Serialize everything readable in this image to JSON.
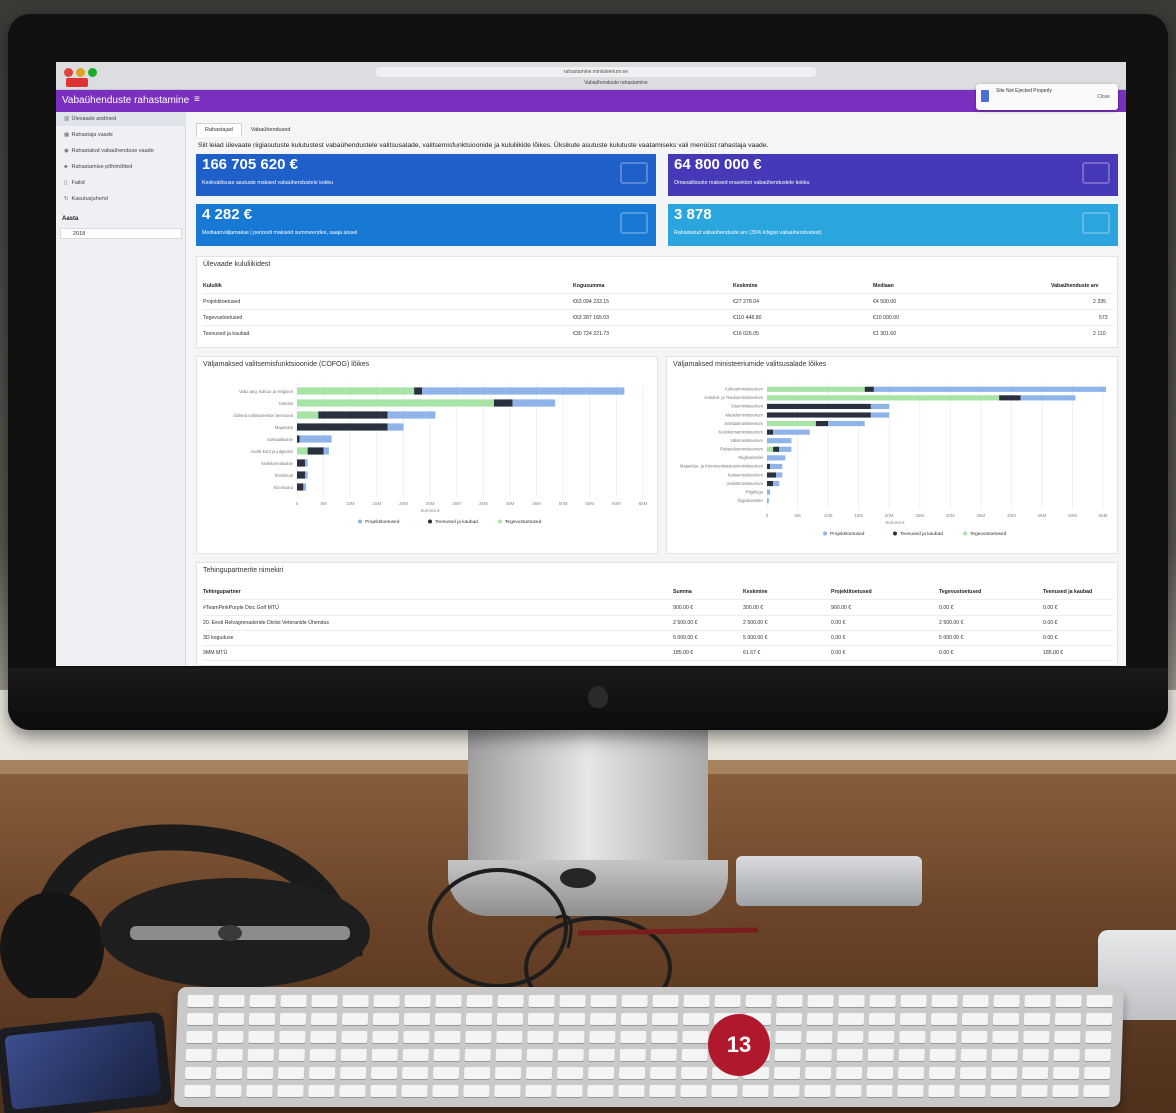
{
  "browser": {
    "url": "rahastamine.ministeerium.ee",
    "tab_title": "Vabaühenduste rahastamine"
  },
  "app": {
    "title": "Vabaühenduste rahastamine",
    "menu_icon": "hamburger-icon"
  },
  "toast": {
    "title": "Site Not Ejected Properly",
    "close_label": "Close"
  },
  "sidebar": {
    "items": [
      {
        "icon": "chart-icon",
        "label": "Ülevaade andmed"
      },
      {
        "icon": "grid-icon",
        "label": "Rahastaja vaade"
      },
      {
        "icon": "globe-icon",
        "label": "Rahastatud vabaühenduse vaade"
      },
      {
        "icon": "people-icon",
        "label": "Rahastamise põhimõtted"
      },
      {
        "icon": "file-icon",
        "label": "Failid"
      },
      {
        "icon": "refresh-icon",
        "label": "Kasutusjuhend"
      }
    ],
    "year_heading": "Aasta",
    "year_value": "2018"
  },
  "tabs": [
    "Rahastajad",
    "Vabaühendused"
  ],
  "intro": "Siit leiad ülevaate riigiasutuste kulutustest vabaühendustele valitsusalade, valitsemisfunktsioonide ja kululiikide lõikes. Üksikute asutuste kulutuste vaatamiseks vali menüüst rahastaja vaade.",
  "cards": [
    {
      "value": "166 705 620 €",
      "label": "Keskvalitsuse asutuste maksed vabaühendustele kokku",
      "color": "#1f5fc9"
    },
    {
      "value": "64 800 000 €",
      "label": "Omavalitsuste maksed erasektori vabaühendustele kokku",
      "color": "#4639b7"
    },
    {
      "value": "4 282 €",
      "label": "Mediaanväljamakse | perioodi makseid summeerides, saaja alusel",
      "color": "#1779d3"
    },
    {
      "value": "3 878",
      "label": "Rahastatud vabaühenduste arv (35% kõigist vabaühendustest)",
      "color": "#2aa5de"
    }
  ],
  "overview": {
    "title": "Ülevaade kululiikidest",
    "headers": [
      "Kululiik",
      "Kogusumma",
      "Keskmine",
      "Mediaan",
      "Vabaühenduste arv"
    ],
    "rows": [
      [
        "Projektitoetused",
        "€63 094 233.15",
        "€27 278.04",
        "€4 500.00",
        "2 335"
      ],
      [
        "Tegevustoetused",
        "€63 287 165.03",
        "€110 448.80",
        "€10 000.00",
        "573"
      ],
      [
        "Teenused ja kaubad",
        "€30 724 221.73",
        "€16 026.05",
        "€1 301.60",
        "2 110"
      ]
    ]
  },
  "cofog_chart": {
    "title": "Väljamaksed valitsemisfunktsioonide (COFOG) lõikes",
    "xlabel": "Summa €",
    "chart_data": {
      "type": "bar",
      "categories": [
        "Vaba aeg, kultuur ja religioon",
        "Haridus",
        "Üldised valitsussektori teenused",
        "Majandus",
        "Sotsiaalkaitse",
        "Avalik kord ja julgeolek",
        "Keskkonnakaitse",
        "Tervishoid",
        "Kinnisvara"
      ],
      "series": [
        {
          "name": "Projektitoetused",
          "color": "#8fb4ea",
          "values": [
            38,
            8,
            9,
            3,
            6,
            1,
            0.5,
            0.5,
            0.5
          ]
        },
        {
          "name": "Teenused ja kaubad",
          "color": "#2b3040",
          "values": [
            1.5,
            3.5,
            13,
            17,
            0.5,
            3,
            1.5,
            1.5,
            1.2
          ]
        },
        {
          "name": "Tegevustoetused",
          "color": "#a7e3a5",
          "values": [
            22,
            37,
            4,
            0,
            0,
            2,
            0,
            0,
            0
          ]
        }
      ],
      "x_ticks": [
        "0",
        "5M",
        "10M",
        "15M",
        "20M",
        "25M",
        "30M",
        "35M",
        "40M",
        "45M",
        "50M",
        "55M",
        "60M",
        "65M"
      ],
      "xlim": [
        0,
        65000000
      ]
    }
  },
  "ministry_chart": {
    "title": "Väljamaksed ministeeriumide valitsusalade lõikes",
    "xlabel": "Summa €",
    "chart_data": {
      "type": "bar",
      "categories": [
        "Kultuuriministeerium",
        "Haridus- ja Teadusministeerium",
        "Siseministeerium",
        "Maaeluministeerium",
        "Sotsiaalministeerium",
        "Keskkonnaministeerium",
        "Välisministeerium",
        "Rahandusministeerium",
        "Riigikantselei",
        "Majandus- ja Kommunikatsiooniministeerium",
        "Kaitseministeerium",
        "Justiitsministeerium",
        "Riigikogu",
        "Õiguskantsler"
      ],
      "series": [
        {
          "name": "Projektitoetused",
          "color": "#8fb4ea",
          "values": [
            38,
            9,
            3,
            3,
            6,
            6,
            4,
            2,
            3,
            2,
            1,
            1,
            0.5,
            0.3
          ]
        },
        {
          "name": "Teenused ja kaubad",
          "color": "#2b3040",
          "values": [
            1.5,
            3.5,
            17,
            17,
            2,
            1,
            0,
            1,
            0,
            0.5,
            1.5,
            1,
            0,
            0
          ]
        },
        {
          "name": "Tegevustoetused",
          "color": "#a7e3a5",
          "values": [
            16,
            38,
            0,
            0,
            8,
            0,
            0,
            1,
            0,
            0,
            0,
            0,
            0,
            0
          ]
        }
      ],
      "x_ticks": [
        "0",
        "5M",
        "10M",
        "15M",
        "20M",
        "25M",
        "30M",
        "35M",
        "40M",
        "45M",
        "50M",
        "55M"
      ],
      "xlim": [
        0,
        55000000
      ]
    }
  },
  "legend": [
    "Projektitoetused",
    "Teenused ja kaubad",
    "Tegevustoetused"
  ],
  "partners": {
    "title": "Tehingupartnerite nimekiri",
    "headers": [
      "Tehingupartner",
      "Summa",
      "Keskmine",
      "Projektitoetused",
      "Tegevustoetused",
      "Teenused ja kaubad"
    ],
    "rows": [
      [
        "#TeamPinkPurple Disc Golf MTÜ",
        "900.00 €",
        "300.00 €",
        "900.00 €",
        "0.00 €",
        "0.00 €"
      ],
      [
        "20. Eesti Relvagrenaderide Diviisi Veteranide Ühendus",
        "2 500.00 €",
        "2 500.00 €",
        "0.00 €",
        "2 500.00 €",
        "0.00 €"
      ],
      [
        "3D koguduse",
        "5 000.00 €",
        "5 000.00 €",
        "0.00 €",
        "5 000.00 €",
        "0.00 €"
      ],
      [
        "9MM MTÜ",
        "185.00 €",
        "61.67 €",
        "0.00 €",
        "0.00 €",
        "185.00 €"
      ]
    ]
  },
  "badge": {
    "number": "13",
    "color": "#b0192d"
  }
}
